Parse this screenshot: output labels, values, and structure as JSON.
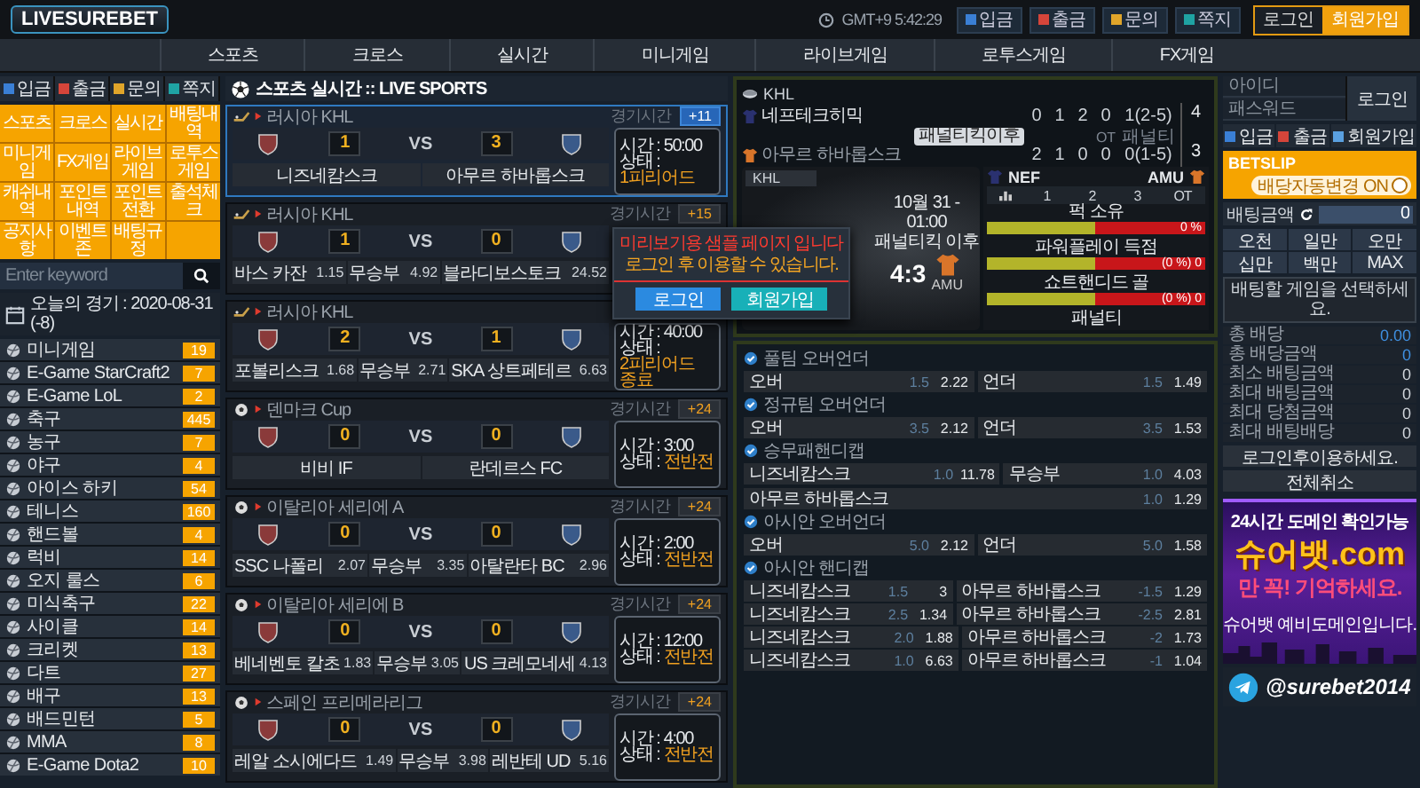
{
  "header": {
    "logo": "LIVESUREBET",
    "clock": "GMT+9 5:42:29",
    "buttons": [
      {
        "label": "입금",
        "color": "#3a7fd5"
      },
      {
        "label": "출금",
        "color": "#d5453a"
      },
      {
        "label": "문의",
        "color": "#e0a52a"
      },
      {
        "label": "쪽지",
        "color": "#1fa3a3"
      }
    ],
    "login": "로그인",
    "signup": "회원가입"
  },
  "nav": [
    "스포츠",
    "크로스",
    "실시간",
    "미니게임",
    "라이브게임",
    "로투스게임",
    "FX게임"
  ],
  "sidebar": {
    "quick": [
      {
        "label": "입금",
        "color": "#3a7fd5"
      },
      {
        "label": "출금",
        "color": "#d5453a"
      },
      {
        "label": "문의",
        "color": "#e0a52a"
      },
      {
        "label": "쪽지",
        "color": "#1fa3a3"
      }
    ],
    "menu": [
      "스포츠",
      "크로스",
      "실시간",
      "배팅내역",
      "미니게임",
      "FX게임",
      "라이브게임",
      "로투스게임",
      "캐쉬내역",
      "포인트내역",
      "포인트전환",
      "출석체크",
      "공지사항",
      "이벤트존",
      "배팅규정"
    ],
    "search": {
      "placeholder": "Enter keyword"
    },
    "today": "오늘의 경기 : 2020-08-31 (-8)",
    "sports": [
      {
        "name": "미니게임",
        "count": "19"
      },
      {
        "name": "E-Game StarCraft2",
        "count": "7"
      },
      {
        "name": "E-Game LoL",
        "count": "2"
      },
      {
        "name": "축구",
        "count": "445"
      },
      {
        "name": "농구",
        "count": "7"
      },
      {
        "name": "야구",
        "count": "4"
      },
      {
        "name": "아이스 하키",
        "count": "54"
      },
      {
        "name": "테니스",
        "count": "160"
      },
      {
        "name": "핸드볼",
        "count": "4"
      },
      {
        "name": "럭비",
        "count": "14"
      },
      {
        "name": "오지 룰스",
        "count": "6"
      },
      {
        "name": "미식축구",
        "count": "22"
      },
      {
        "name": "사이클",
        "count": "14"
      },
      {
        "name": "크리켓",
        "count": "13"
      },
      {
        "name": "다트",
        "count": "27"
      },
      {
        "name": "배구",
        "count": "13"
      },
      {
        "name": "배드민턴",
        "count": "5"
      },
      {
        "name": "MMA",
        "count": "8"
      },
      {
        "name": "E-Game Dota2",
        "count": "10"
      }
    ]
  },
  "live": {
    "title": "스포츠 실시간 :: LIVE SPORTS",
    "matches": [
      {
        "kind": "hockey",
        "league": "러시아 KHL",
        "selected": true,
        "time_label": "경기시간",
        "badge": "+11",
        "scores": [
          "1",
          "3"
        ],
        "vs": "VS",
        "cells": [
          {
            "name": "니즈네캄스크"
          },
          {
            "name": "아무르 하바롭스크"
          }
        ],
        "info": {
          "time": "시간 : 50:00",
          "status_label": "상태 :",
          "status": "1피리어드"
        }
      },
      {
        "kind": "hockey",
        "league": "러시아 KHL",
        "selected": false,
        "time_label": "경기시간",
        "badge": "+15",
        "scores": [
          "1",
          "0"
        ],
        "vs": "VS",
        "cells": [
          {
            "name": "바스 카잔",
            "odds": "1.15"
          },
          {
            "name": "무승부",
            "odds": "4.92"
          },
          {
            "name": "블라디보스토크",
            "odds": "24.52"
          }
        ],
        "popup": {
          "lines": [
            "미리보기용 샘플 페이지 입니다",
            "로그인 후 이용할 수 있습니다."
          ],
          "login": "로그인",
          "signup": "회원가입"
        }
      },
      {
        "kind": "hockey",
        "league": "러시아 KHL",
        "selected": false,
        "scores": [
          "2",
          "1"
        ],
        "vs": "VS",
        "cells": [
          {
            "name": "포볼리스크",
            "odds": "1.68"
          },
          {
            "name": "무승부",
            "odds": "2.71"
          },
          {
            "name": "SKA 상트페테르",
            "odds": "6.63"
          }
        ],
        "info": {
          "time": "시간 : 40:00",
          "status_label": "상태 :",
          "status": "2피리어드 종료"
        }
      },
      {
        "kind": "soccer",
        "league": "덴마크 Cup",
        "selected": false,
        "time_label": "경기시간",
        "badge": "+24",
        "scores": [
          "0",
          "0"
        ],
        "vs": "VS",
        "cells": [
          {
            "name": "비비 IF"
          },
          {
            "name": "란데르스 FC"
          }
        ],
        "info": {
          "time": "시간 : 3:00",
          "status_label": "상태 :",
          "status": "전반전"
        }
      },
      {
        "kind": "soccer",
        "league": "이탈리아 세리에 A",
        "selected": false,
        "time_label": "경기시간",
        "badge": "+24",
        "scores": [
          "0",
          "0"
        ],
        "vs": "VS",
        "cells": [
          {
            "name": "SSC 나폴리",
            "odds": "2.07"
          },
          {
            "name": "무승부",
            "odds": "3.35"
          },
          {
            "name": "아탈란타 BC",
            "odds": "2.96"
          }
        ],
        "info": {
          "time": "시간 : 2:00",
          "status_label": "상태 :",
          "status": "전반전"
        }
      },
      {
        "kind": "soccer",
        "league": "이탈리아 세리에 B",
        "selected": false,
        "time_label": "경기시간",
        "badge": "+24",
        "scores": [
          "0",
          "0"
        ],
        "vs": "VS",
        "cells": [
          {
            "name": "베네벤토 칼초",
            "odds": "1.83"
          },
          {
            "name": "무승부",
            "odds": "3.05"
          },
          {
            "name": "US 크레모네세",
            "odds": "4.13"
          }
        ],
        "info": {
          "time": "시간 : 12:00",
          "status_label": "상태 :",
          "status": "전반전"
        }
      },
      {
        "kind": "soccer",
        "league": "스페인 프리메라리그",
        "selected": false,
        "time_label": "경기시간",
        "badge": "+24",
        "scores": [
          "0",
          "0"
        ],
        "vs": "VS",
        "cells": [
          {
            "name": "레알 소시에다드",
            "odds": "1.49"
          },
          {
            "name": "무승부",
            "odds": "3.98"
          },
          {
            "name": "레반테 UD",
            "odds": "5.16"
          }
        ],
        "info": {
          "time": "시간 : 4:00",
          "status_label": "상태 :",
          "status": "전반전"
        }
      }
    ]
  },
  "detail": {
    "league": "KHL",
    "teams": [
      {
        "name": "네프테크히믹",
        "color": "#2a3170",
        "periods": [
          "0",
          "1",
          "2",
          "0"
        ],
        "pen": "1(2-5)",
        "total": "4"
      },
      {
        "name": "아무르 하바롭스크",
        "color": "#d9752a",
        "periods": [
          "2",
          "1",
          "0",
          "0"
        ],
        "pen": "0(1-5)",
        "total": "3"
      }
    ],
    "note": "패널티킥이후",
    "mid_labels": [
      "OT",
      "패널티"
    ],
    "field": {
      "tag": "KHL",
      "date": "10월 31 - 01:00",
      "phase": "패널티킥 이후",
      "score": "4:3",
      "team": "AMU"
    },
    "stats": {
      "home": "NEF",
      "away": "AMU",
      "tabs": [
        "1",
        "2",
        "3",
        "OT"
      ],
      "items": [
        {
          "label": "퍽 소유",
          "value": "0 %"
        },
        {
          "label": "파워플레이 득점",
          "value": "(0 %) 0"
        },
        {
          "label": "쇼트핸디드 골",
          "value": "(0 %) 0"
        }
      ],
      "footer": "패널티"
    },
    "markets": [
      {
        "title": "풀팀 오버언더",
        "rows": [
          [
            {
              "name": "오버",
              "line": "1.5",
              "odds": "2.22"
            },
            {
              "name": "언더",
              "line": "1.5",
              "odds": "1.49"
            }
          ]
        ]
      },
      {
        "title": "정규팀 오버언더",
        "rows": [
          [
            {
              "name": "오버",
              "line": "3.5",
              "odds": "2.12"
            },
            {
              "name": "언더",
              "line": "3.5",
              "odds": "1.53"
            }
          ]
        ]
      },
      {
        "title": "승무패핸디캡",
        "rows": [
          [
            {
              "name": "니즈네캄스크",
              "line": "1.0",
              "odds": "11.78"
            },
            {
              "name": "무승부",
              "line": "1.0",
              "odds": "4.03"
            },
            {
              "name": "아무르 하바롭스크",
              "line": "1.0",
              "odds": "1.29"
            }
          ]
        ]
      },
      {
        "title": "아시안 오버언더",
        "rows": [
          [
            {
              "name": "오버",
              "line": "5.0",
              "odds": "2.12"
            },
            {
              "name": "언더",
              "line": "5.0",
              "odds": "1.58"
            }
          ]
        ]
      },
      {
        "title": "아시안 핸디캡",
        "rows": [
          [
            {
              "name": "니즈네캄스크",
              "line": "1.5",
              "odds": "3"
            },
            {
              "name": "아무르 하바롭스크",
              "line": "-1.5",
              "odds": "1.29"
            }
          ],
          [
            {
              "name": "니즈네캄스크",
              "line": "2.5",
              "odds": "1.34"
            },
            {
              "name": "아무르 하바롭스크",
              "line": "-2.5",
              "odds": "2.81"
            }
          ],
          [
            {
              "name": "니즈네캄스크",
              "line": "2.0",
              "odds": "1.88"
            },
            {
              "name": "아무르 하바롭스크",
              "line": "-2",
              "odds": "1.73"
            }
          ],
          [
            {
              "name": "니즈네캄스크",
              "line": "1.0",
              "odds": "6.63"
            },
            {
              "name": "아무르 하바롭스크",
              "line": "-1",
              "odds": "1.04"
            }
          ]
        ]
      }
    ]
  },
  "account": {
    "id_placeholder": "아이디",
    "pw_placeholder": "패스워드",
    "login": "로그인",
    "buttons": [
      {
        "label": "입금",
        "color": "#3a7fd5"
      },
      {
        "label": "출금",
        "color": "#d5453a"
      },
      {
        "label": "회원가입",
        "color": "#5aa0e0"
      }
    ]
  },
  "betslip": {
    "title": "BETSLIP",
    "auto": {
      "label": "배당자동변경 ON",
      "on": true
    },
    "amount_label": "배팅금액",
    "amount": "0",
    "quick": [
      "오천",
      "일만",
      "오만",
      "십만",
      "백만",
      "MAX"
    ],
    "message": "배팅할 게임을 선택하세요.",
    "rows": [
      {
        "label": "총 배당",
        "value": "0.00",
        "emphasis": true
      },
      {
        "label": "총 배당금액",
        "value": "0",
        "emphasis": true
      },
      {
        "label": "최소 배팅금액",
        "value": "0",
        "emphasis": false
      },
      {
        "label": "최대 배팅금액",
        "value": "0",
        "emphasis": false
      },
      {
        "label": "최대 당첨금액",
        "value": "0",
        "emphasis": false
      },
      {
        "label": "최대 배팅배당",
        "value": "0",
        "emphasis": false
      }
    ],
    "login_button": "로그인후이용하세요.",
    "cancel_button": "전체취소"
  },
  "banner": {
    "headline": "24시간 도메인 확인가능",
    "brand": "슈어뱃.com",
    "slogan": "만 꼭! 기억하세요.",
    "note": "슈어뱃 예비도메인입니다."
  },
  "telegram": "@surebet2014"
}
